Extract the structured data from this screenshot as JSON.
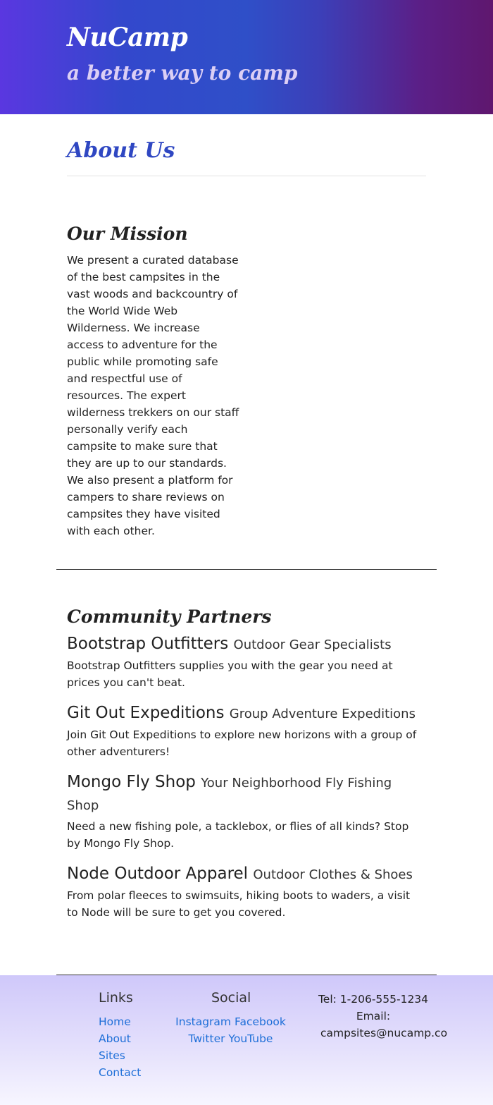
{
  "header": {
    "brand": "NuCamp",
    "tagline": "a better way to camp"
  },
  "about": {
    "title": "About Us",
    "mission_title": "Our Mission",
    "mission_text": "We present a curated database of the best campsites in the vast woods and backcountry of the World Wide Web Wilderness. We increase access to adventure for the public while promoting safe and respectful use of resources. The expert wilderness trekkers on our staff personally verify each campsite to make sure that they are up to our standards. We also present a platform for campers to share reviews on campsites they have visited with each other."
  },
  "partners": {
    "title": "Community Partners",
    "items": [
      {
        "name": "Bootstrap Outfitters",
        "tagline": "Outdoor Gear Specialists",
        "description": "Bootstrap Outfitters supplies you with the gear you need at prices you can't beat."
      },
      {
        "name": "Git Out Expeditions",
        "tagline": "Group Adventure Expeditions",
        "description": "Join Git Out Expeditions to explore new horizons with a group of other adventurers!"
      },
      {
        "name": "Mongo Fly Shop",
        "tagline": "Your Neighborhood Fly Fishing Shop",
        "description": "Need a new fishing pole, a tacklebox, or flies of all kinds? Stop by Mongo Fly Shop."
      },
      {
        "name": "Node Outdoor Apparel",
        "tagline": "Outdoor Clothes & Shoes",
        "description": "From polar fleeces to swimsuits, hiking boots to waders, a visit to Node will be sure to get you covered."
      }
    ]
  },
  "footer": {
    "links_title": "Links",
    "links": [
      "Home",
      "About",
      "Sites",
      "Contact"
    ],
    "social_title": "Social",
    "social": [
      "Instagram",
      "Facebook",
      "Twitter",
      "YouTube"
    ],
    "tel": "Tel: 1-206-555-1234",
    "email_label": "Email:",
    "email": "campsites@nucamp.co"
  }
}
